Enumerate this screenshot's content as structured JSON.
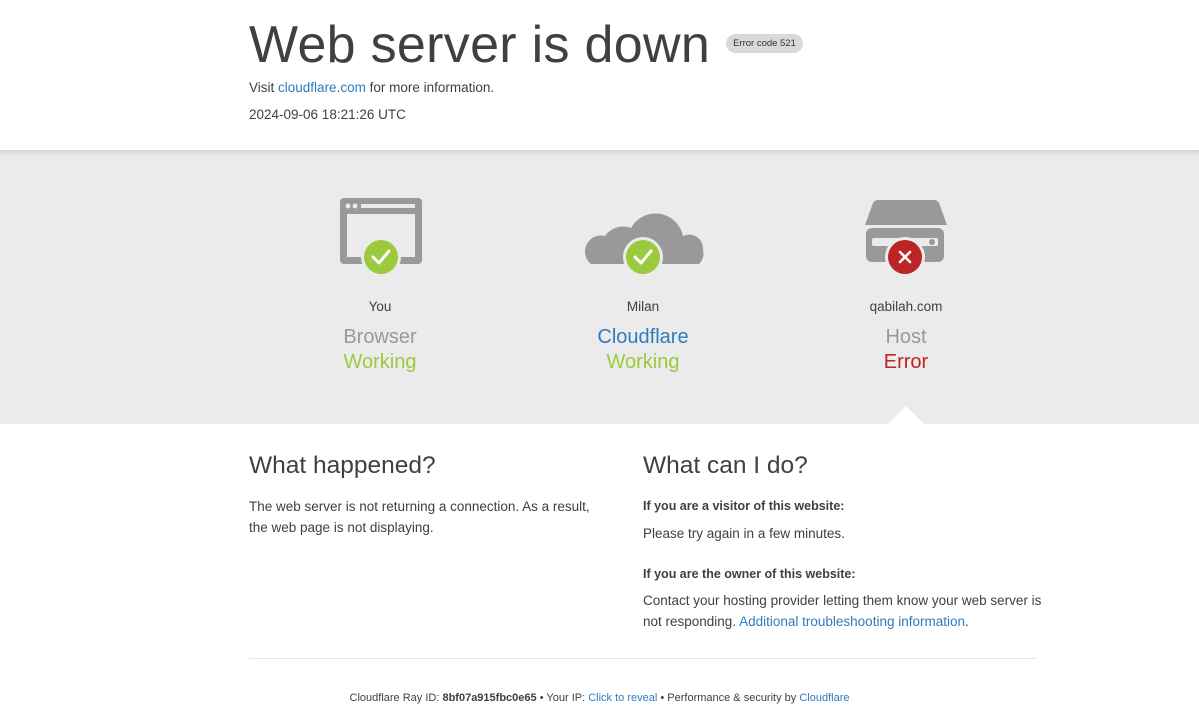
{
  "header": {
    "title": "Web server is down",
    "error_badge": "Error code 521",
    "visit_prefix": "Visit",
    "visit_link": "cloudflare.com",
    "visit_suffix": "for more information.",
    "timestamp": "2024-09-06 18:21:26 UTC"
  },
  "status": {
    "columns": [
      {
        "location": "You",
        "kind": "Browser",
        "status": "Working",
        "icon": "browser-icon",
        "badge": "check-icon"
      },
      {
        "location": "Milan",
        "kind": "Cloudflare",
        "status": "Working",
        "icon": "cloud-icon",
        "badge": "check-icon"
      },
      {
        "location": "qabilah.com",
        "kind": "Host",
        "status": "Error",
        "icon": "server-icon",
        "badge": "x-icon"
      }
    ],
    "colors": {
      "ok": "#9bca3e",
      "error": "#bd2426",
      "icon_gray": "#999999",
      "link": "#2f7bbf"
    }
  },
  "what_happened": {
    "heading": "What happened?",
    "body": "The web server is not returning a connection. As a result, the web page is not displaying."
  },
  "what_can_i_do": {
    "heading": "What can I do?",
    "visitor_heading": "If you are a visitor of this website:",
    "visitor_body": "Please try again in a few minutes.",
    "owner_heading": "If you are the owner of this website:",
    "owner_body": "Contact your hosting provider letting them know your web server is not responding.",
    "owner_link": "Additional troubleshooting information",
    "owner_link_suffix": "."
  },
  "footer": {
    "ray_label": "Cloudflare Ray ID:",
    "ray_id": "8bf07a915fbc0e65",
    "sep1": "•",
    "ip_label": "Your IP:",
    "ip_link": "Click to reveal",
    "sep2": "•",
    "perf_label": "Performance & security by",
    "perf_link": "Cloudflare"
  }
}
